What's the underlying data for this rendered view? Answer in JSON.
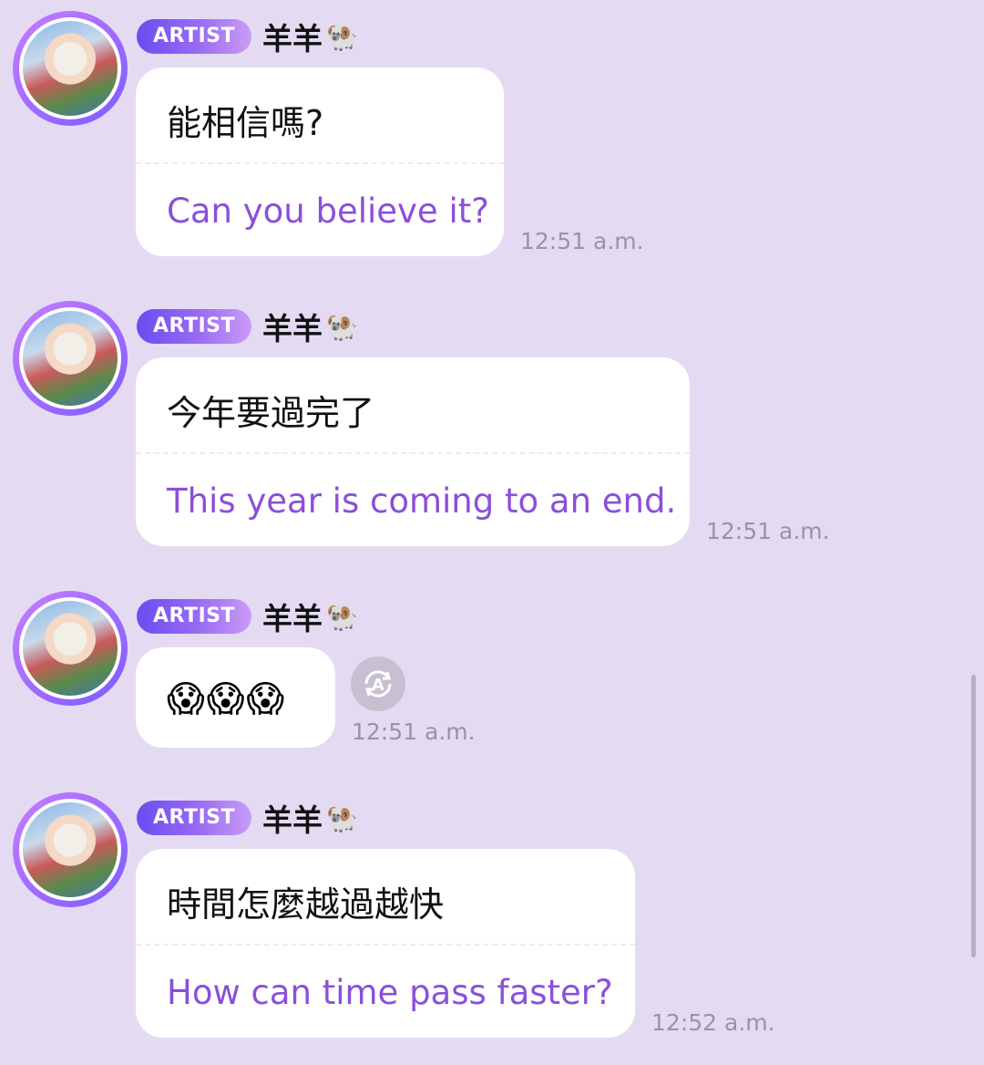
{
  "messages": [
    {
      "badge": "ARTIST",
      "name": "羊羊",
      "name_icon": "🐏",
      "original": "能相信嗎?",
      "translation": "Can you believe it?",
      "time": "12:51 a.m."
    },
    {
      "badge": "ARTIST",
      "name": "羊羊",
      "name_icon": "🐏",
      "original": "今年要過完了",
      "translation": "This year is coming to an end.",
      "time": "12:51 a.m."
    },
    {
      "badge": "ARTIST",
      "name": "羊羊",
      "name_icon": "🐏",
      "emojis": "😱😱😱",
      "time": "12:51 a.m.",
      "translate_icon": "translate-icon"
    },
    {
      "badge": "ARTIST",
      "name": "羊羊",
      "name_icon": "🐏",
      "original": "時間怎麼越過越快",
      "translation": "How can time pass faster?",
      "time": "12:52 a.m."
    }
  ]
}
